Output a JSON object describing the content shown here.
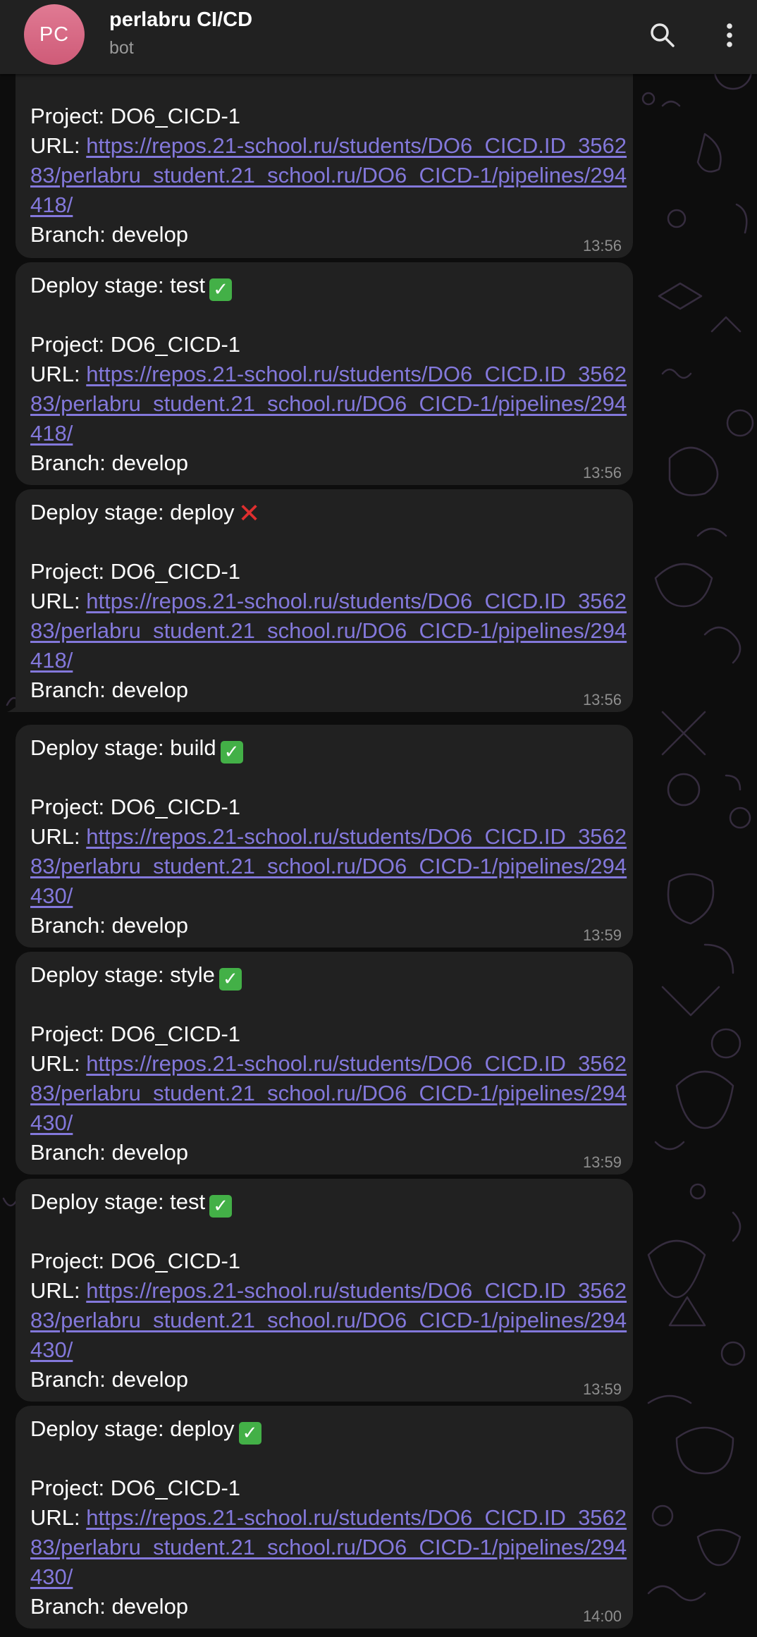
{
  "header": {
    "avatar_initials": "PC",
    "title": "perlabru CI/CD",
    "subtitle": "bot",
    "search_icon": "search-icon",
    "menu_icon": "more-vertical-icon"
  },
  "labels": {
    "project_prefix": "Project: ",
    "url_prefix": "URL: ",
    "branch_prefix": "Branch: ",
    "stage_prefix": "Deploy stage: "
  },
  "messages": [
    {
      "stage_text": "",
      "status": "",
      "project": "DO6_CICD-1",
      "url": "https://repos.21-school.ru/students/DO6_CICD.ID_356283/perlabru_student.21_school.ru/DO6_CICD-1/pipelines/294418/",
      "branch": "develop",
      "time": "13:56"
    },
    {
      "stage_text": "test",
      "status": "success",
      "project": "DO6_CICD-1",
      "url": "https://repos.21-school.ru/students/DO6_CICD.ID_356283/perlabru_student.21_school.ru/DO6_CICD-1/pipelines/294418/",
      "branch": "develop",
      "time": "13:56"
    },
    {
      "stage_text": "deploy",
      "status": "failed",
      "project": "DO6_CICD-1",
      "url": "https://repos.21-school.ru/students/DO6_CICD.ID_356283/perlabru_student.21_school.ru/DO6_CICD-1/pipelines/294418/",
      "branch": "develop",
      "time": "13:56"
    },
    {
      "stage_text": "build",
      "status": "success",
      "project": "DO6_CICD-1",
      "url": "https://repos.21-school.ru/students/DO6_CICD.ID_356283/perlabru_student.21_school.ru/DO6_CICD-1/pipelines/294430/",
      "branch": "develop",
      "time": "13:59"
    },
    {
      "stage_text": "style",
      "status": "success",
      "project": "DO6_CICD-1",
      "url": "https://repos.21-school.ru/students/DO6_CICD.ID_356283/perlabru_student.21_school.ru/DO6_CICD-1/pipelines/294430/",
      "branch": "develop",
      "time": "13:59"
    },
    {
      "stage_text": "test",
      "status": "success",
      "project": "DO6_CICD-1",
      "url": "https://repos.21-school.ru/students/DO6_CICD.ID_356283/perlabru_student.21_school.ru/DO6_CICD-1/pipelines/294430/",
      "branch": "develop",
      "time": "13:59"
    },
    {
      "stage_text": "deploy",
      "status": "success",
      "project": "DO6_CICD-1",
      "url": "https://repos.21-school.ru/students/DO6_CICD.ID_356283/perlabru_student.21_school.ru/DO6_CICD-1/pipelines/294430/",
      "branch": "develop",
      "time": "14:00"
    }
  ],
  "colors": {
    "header_bg": "#212121",
    "bubble_bg": "#212121",
    "link": "#8378db",
    "avatar": "#d96884",
    "success": "#43b047",
    "failed": "#e02f2f"
  }
}
